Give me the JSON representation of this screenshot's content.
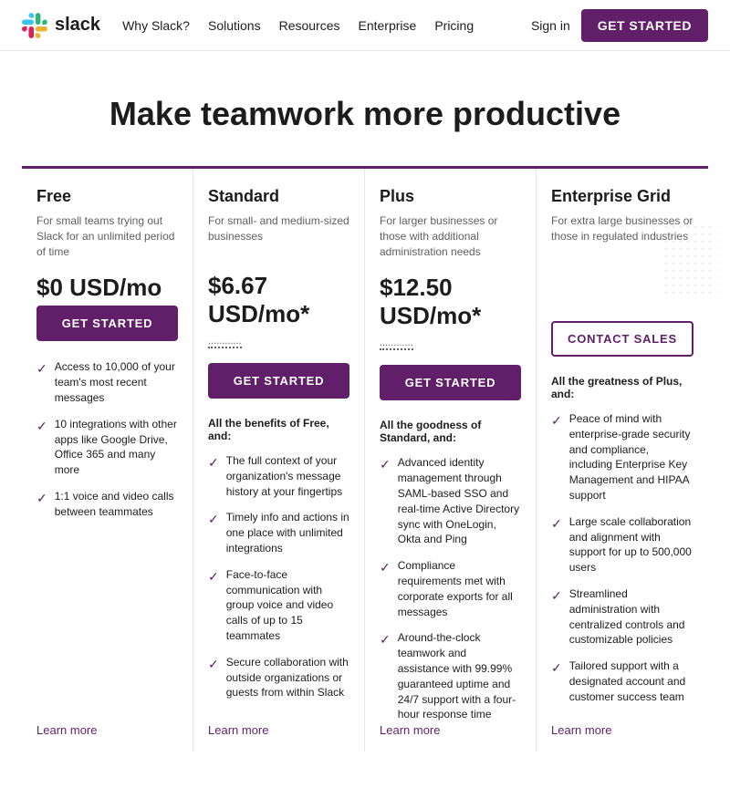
{
  "nav": {
    "logo_text": "slack",
    "links": [
      "Why Slack?",
      "Solutions",
      "Resources",
      "Enterprise",
      "Pricing"
    ],
    "signin": "Sign in",
    "get_started": "GET STARTED"
  },
  "hero": {
    "title": "Make teamwork more productive"
  },
  "plans": [
    {
      "name": "Free",
      "desc": "For small teams trying out Slack for an unlimited period of time",
      "price": "$0 USD/mo",
      "price_note": null,
      "cta": "GET STARTED",
      "cta_type": "primary",
      "features_heading": null,
      "features": [
        "Access to 10,000 of your team's most recent messages",
        "10 integrations with other apps like Google Drive, Office 365 and many more",
        "1:1 voice and video calls between teammates"
      ],
      "learn_more": "Learn more"
    },
    {
      "name": "Standard",
      "desc": "For small- and medium-sized businesses",
      "price": "$6.67 USD/mo*",
      "price_note": "............",
      "cta": "GET STARTED",
      "cta_type": "primary",
      "features_heading": "All the benefits of Free, and:",
      "features": [
        "The full context of your organization's message history at your fingertips",
        "Timely info and actions in one place with unlimited integrations",
        "Face-to-face communication with group voice and video calls of up to 15 teammates",
        "Secure collaboration with outside organizations or guests from within Slack"
      ],
      "learn_more": "Learn more"
    },
    {
      "name": "Plus",
      "desc": "For larger businesses or those with additional administration needs",
      "price": "$12.50 USD/mo*",
      "price_note": "............",
      "cta": "GET STARTED",
      "cta_type": "primary",
      "features_heading": "All the goodness of Standard, and:",
      "features": [
        "Advanced identity management through SAML-based SSO and real-time Active Directory sync with OneLogin, Okta and Ping",
        "Compliance requirements met with corporate exports for all messages",
        "Around-the-clock teamwork and assistance with 99.99% guaranteed uptime and 24/7 support with a four-hour response time"
      ],
      "learn_more": "Learn more"
    },
    {
      "name": "Enterprise Grid",
      "desc": "For extra large businesses or those in regulated industries",
      "price": null,
      "price_note": null,
      "cta": "CONTACT SALES",
      "cta_type": "outline",
      "features_heading": "All the greatness of Plus, and:",
      "features": [
        "Peace of mind with enterprise-grade security and compliance, including Enterprise Key Management and HIPAA support",
        "Large scale collaboration and alignment with support for up to 500,000 users",
        "Streamlined administration with centralized controls and customizable policies",
        "Tailored support with a designated account and customer success team"
      ],
      "learn_more": "Learn more"
    }
  ]
}
